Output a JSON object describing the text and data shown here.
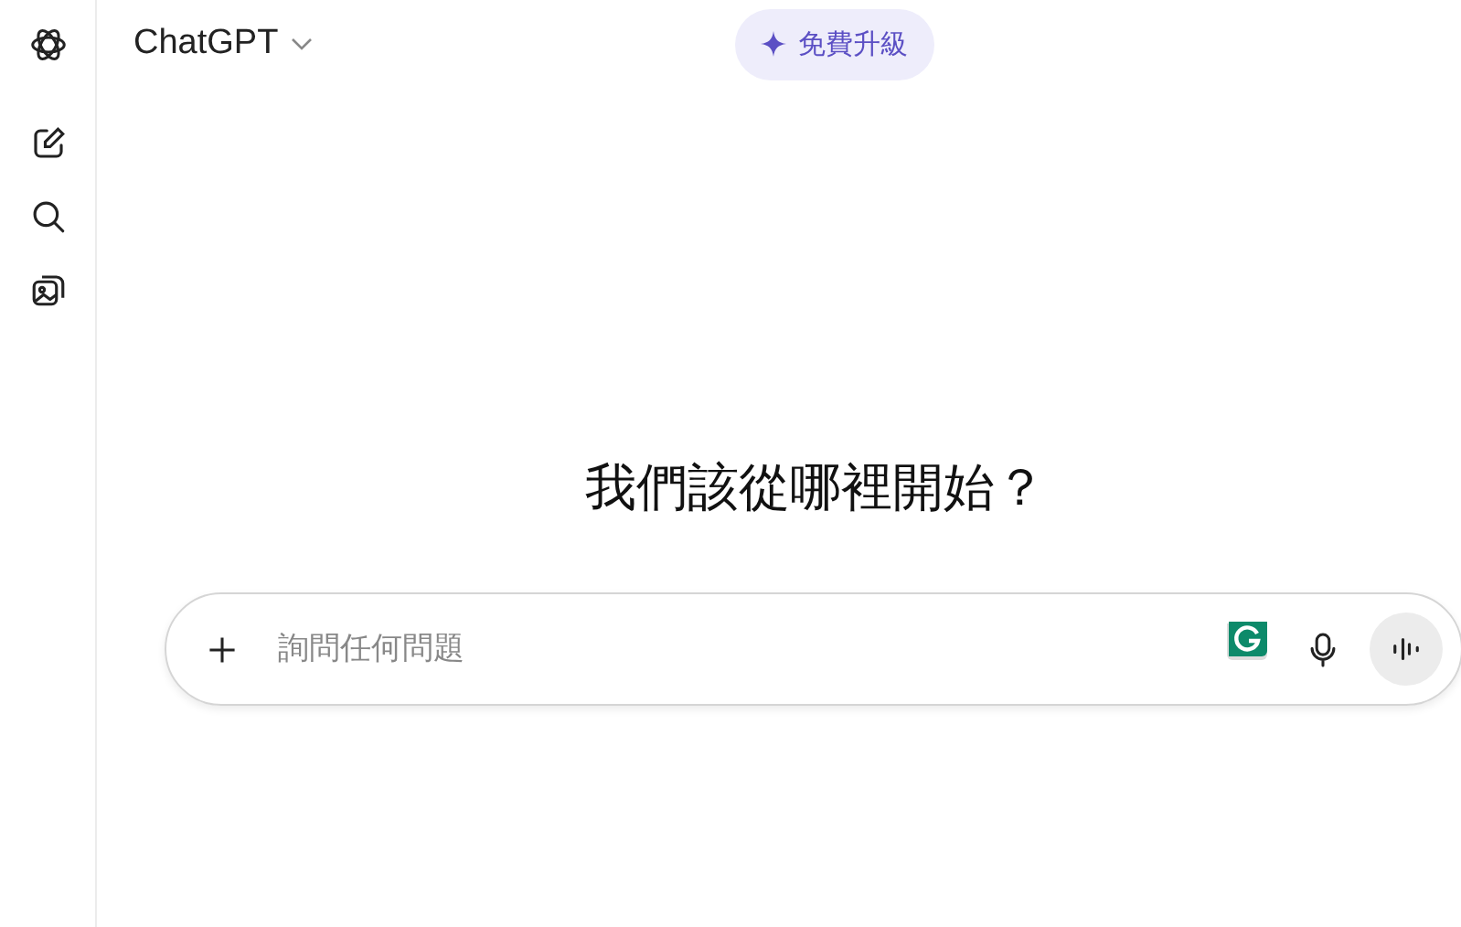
{
  "header": {
    "model_name": "ChatGPT",
    "upgrade_button": "免費升級"
  },
  "heading": "我們該從哪裡開始？",
  "composer": {
    "placeholder": "詢問任何問題"
  }
}
